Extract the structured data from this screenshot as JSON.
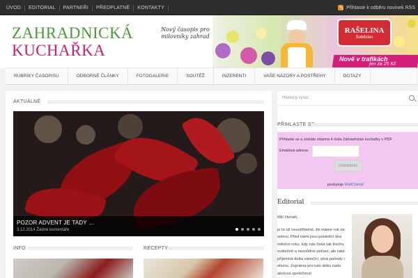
{
  "topnav": {
    "items": [
      "ÚVOD",
      "EDITORIAL",
      "PARTNEŘI",
      "PŘEDPLATNÉ",
      "KONTAKTY"
    ],
    "rss_label": "Přihlaste k odběru novinek RSS"
  },
  "header": {
    "logo_line1": "ZAHRADNICKÁ",
    "logo_line2": "KUCHAŘKA",
    "tagline": "Nový časopis pro milovníky zahrad",
    "banner": {
      "brand": "RAŠELINA",
      "brand_sub": "Soběslav",
      "promo_line1": "Nově v trafikách",
      "promo_line2": "jen za 25 Kč"
    }
  },
  "nav": {
    "items": [
      "RUBRIKY ČASOPISU",
      "ODBORNÉ ČLÁNKY",
      "FOTOGALERIE",
      "SOUTĚŽ",
      "INZERENTI",
      "VAŠE NÁZORY A POSTŘEHY",
      "DOTAZY"
    ]
  },
  "main": {
    "section_label": "AKTUÁLNĚ",
    "slide": {
      "title": "POZOR ADVENT JE TADY ...",
      "date": "3.12.2014",
      "comments": "Žádné komentáře"
    },
    "col1_label": "INFO",
    "col2_label": "RECEPTY"
  },
  "sidebar": {
    "search_placeholder": "Hledaný výraz",
    "subscribe": {
      "heading": "PŘIHLASTE SE",
      "intro": "Přihlaste se a získáte zdarma 4 čísla Zahradnické kuchařky v PDF",
      "email_label": "Emailová adresa",
      "button": "ODEBÍRAT",
      "powered_prefix": "poskytuje",
      "powered_brand": "MailChimp!"
    },
    "editorial": {
      "title": "Editorial",
      "greeting": "Milí čtenáři,",
      "body": "je to už neuvěřitelné, že máme rok za sebou. Před námi jsou poslední dva měsíce roku, kdy nás čeká tak trochu svátečně a nesvůdné počasí, ale také příjemná doba vánoční, plná pohody i shonu. Zejména pro tuto dobu naše akciová společnost"
    }
  },
  "colors": {
    "logo_green": "#4d9a38",
    "logo_pink": "#c61f6e",
    "subscribe_bg": "#f2c8f0",
    "topbar_bg": "#2e2e2e"
  }
}
